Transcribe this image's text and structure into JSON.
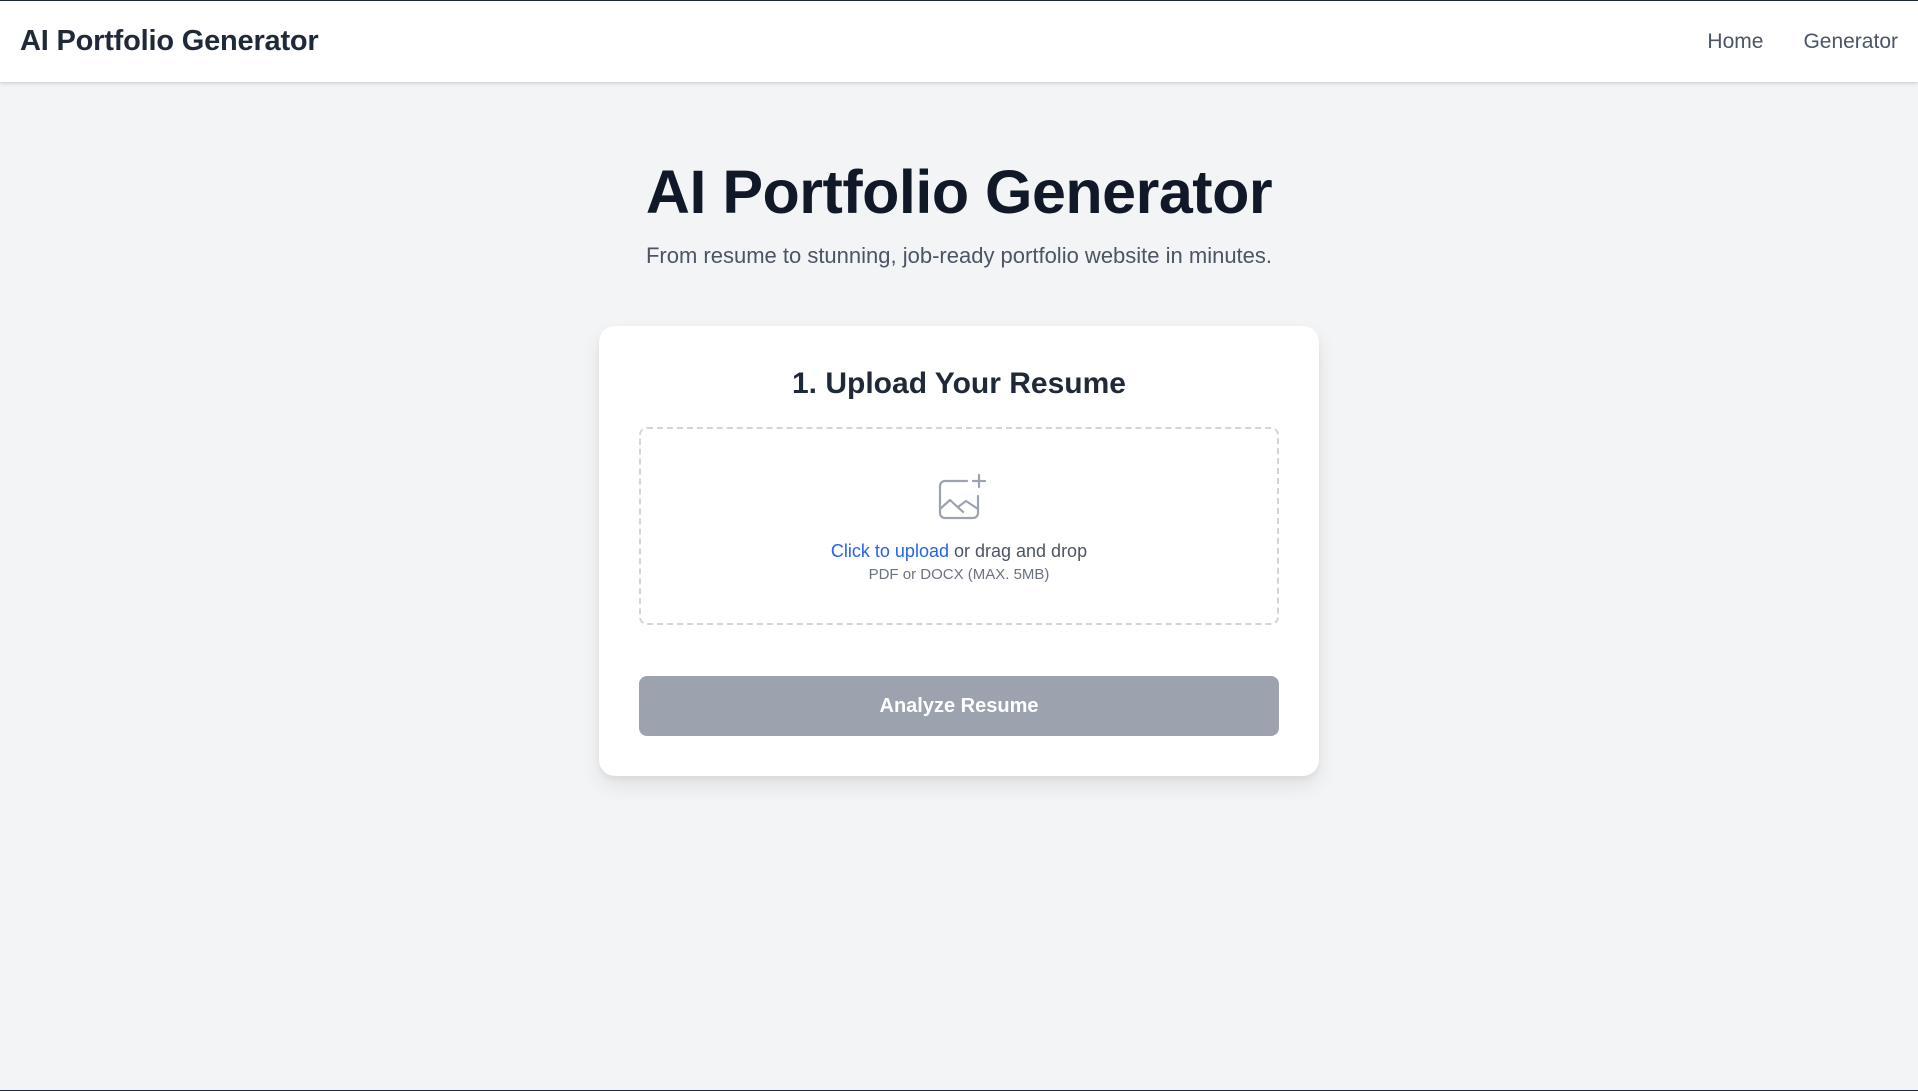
{
  "header": {
    "brand": "AI Portfolio Generator",
    "nav": [
      {
        "label": "Home"
      },
      {
        "label": "Generator"
      }
    ]
  },
  "hero": {
    "title": "AI Portfolio Generator",
    "subtitle": "From resume to stunning, job-ready portfolio website in minutes."
  },
  "upload_card": {
    "title": "1. Upload Your Resume",
    "dropzone": {
      "icon": "image-add-icon",
      "link_text": "Click to upload",
      "rest_text": " or drag and drop",
      "hint": "PDF or DOCX (MAX. 5MB)"
    },
    "button_label": "Analyze Resume",
    "button_state": "disabled"
  },
  "colors": {
    "background": "#f3f4f6",
    "link": "#2563eb",
    "button_disabled": "#9ca3af",
    "text_dark": "#111827",
    "text_muted": "#4b5563"
  }
}
